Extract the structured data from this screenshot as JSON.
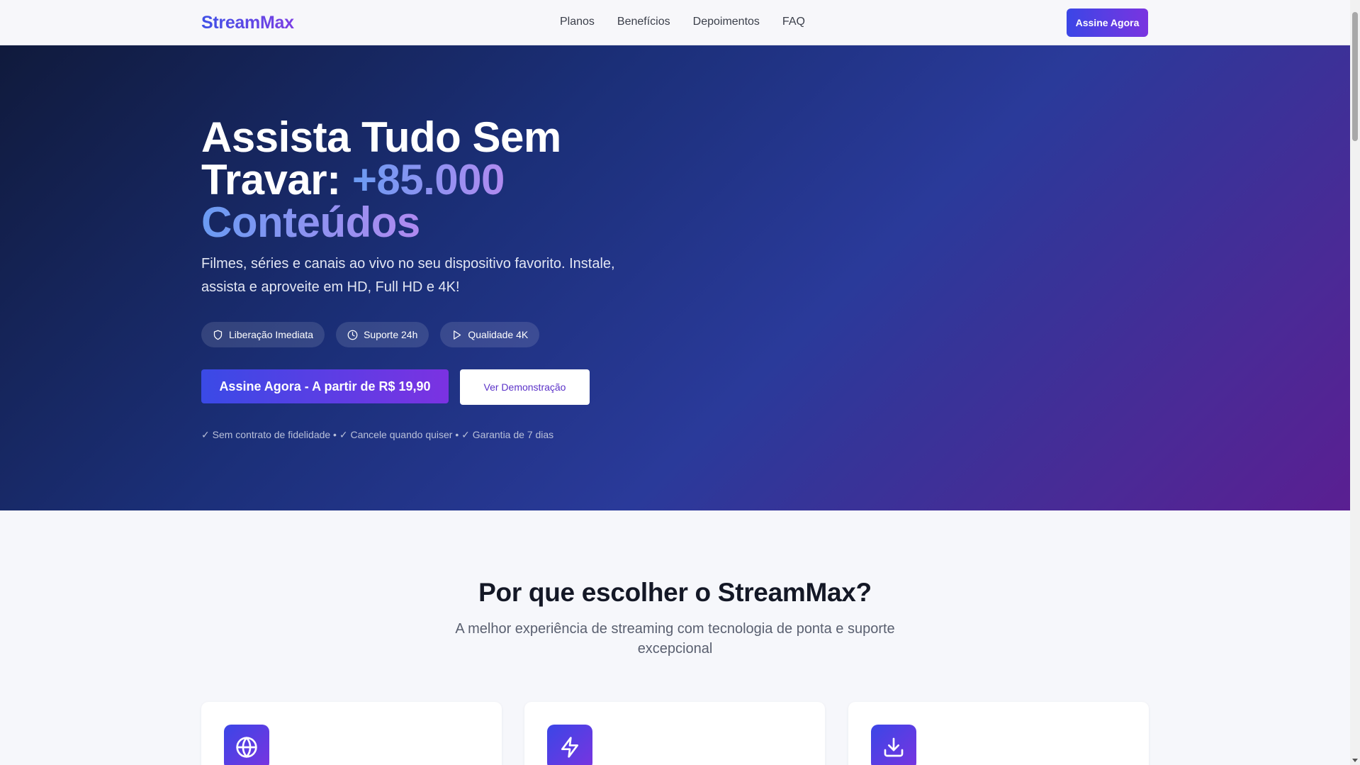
{
  "brand": "StreamMax",
  "nav": {
    "links": [
      "Planos",
      "Benefícios",
      "Depoimentos",
      "FAQ"
    ],
    "cta": "Assine Agora"
  },
  "hero": {
    "title_line1": "Assista Tudo Sem",
    "title_line2": "Travar:",
    "title_highlight1": "+85.000",
    "title_highlight2": "Conteúdos",
    "subtitle": "Filmes, séries e canais ao vivo no seu dispositivo favorito. Instale, assista e aproveite em HD, Full HD e 4K!",
    "pills": [
      {
        "label": "Liberação Imediata",
        "icon": "shield-icon"
      },
      {
        "label": "Suporte 24h",
        "icon": "clock-icon"
      },
      {
        "label": "Qualidade 4K",
        "icon": "play-icon"
      }
    ],
    "primary_cta": "Assine Agora - A partir de R$ 19,90",
    "secondary_cta": "Ver Demonstração",
    "guarantees": "✓ Sem contrato de fidelidade • ✓ Cancele quando quiser • ✓ Garantia de 7 dias"
  },
  "features": {
    "title": "Por que escolher o StreamMax?",
    "subtitle": "A melhor experiência de streaming com tecnologia de ponta e suporte excepcional",
    "cards": [
      {
        "icon": "globe-icon"
      },
      {
        "icon": "lightning-icon"
      },
      {
        "icon": "download-icon"
      }
    ]
  },
  "colors": {
    "accent_start": "#3b46e6",
    "accent_end": "#7a34e0",
    "hero_dark": "#101a3c",
    "hero_purple": "#5a1f92"
  }
}
